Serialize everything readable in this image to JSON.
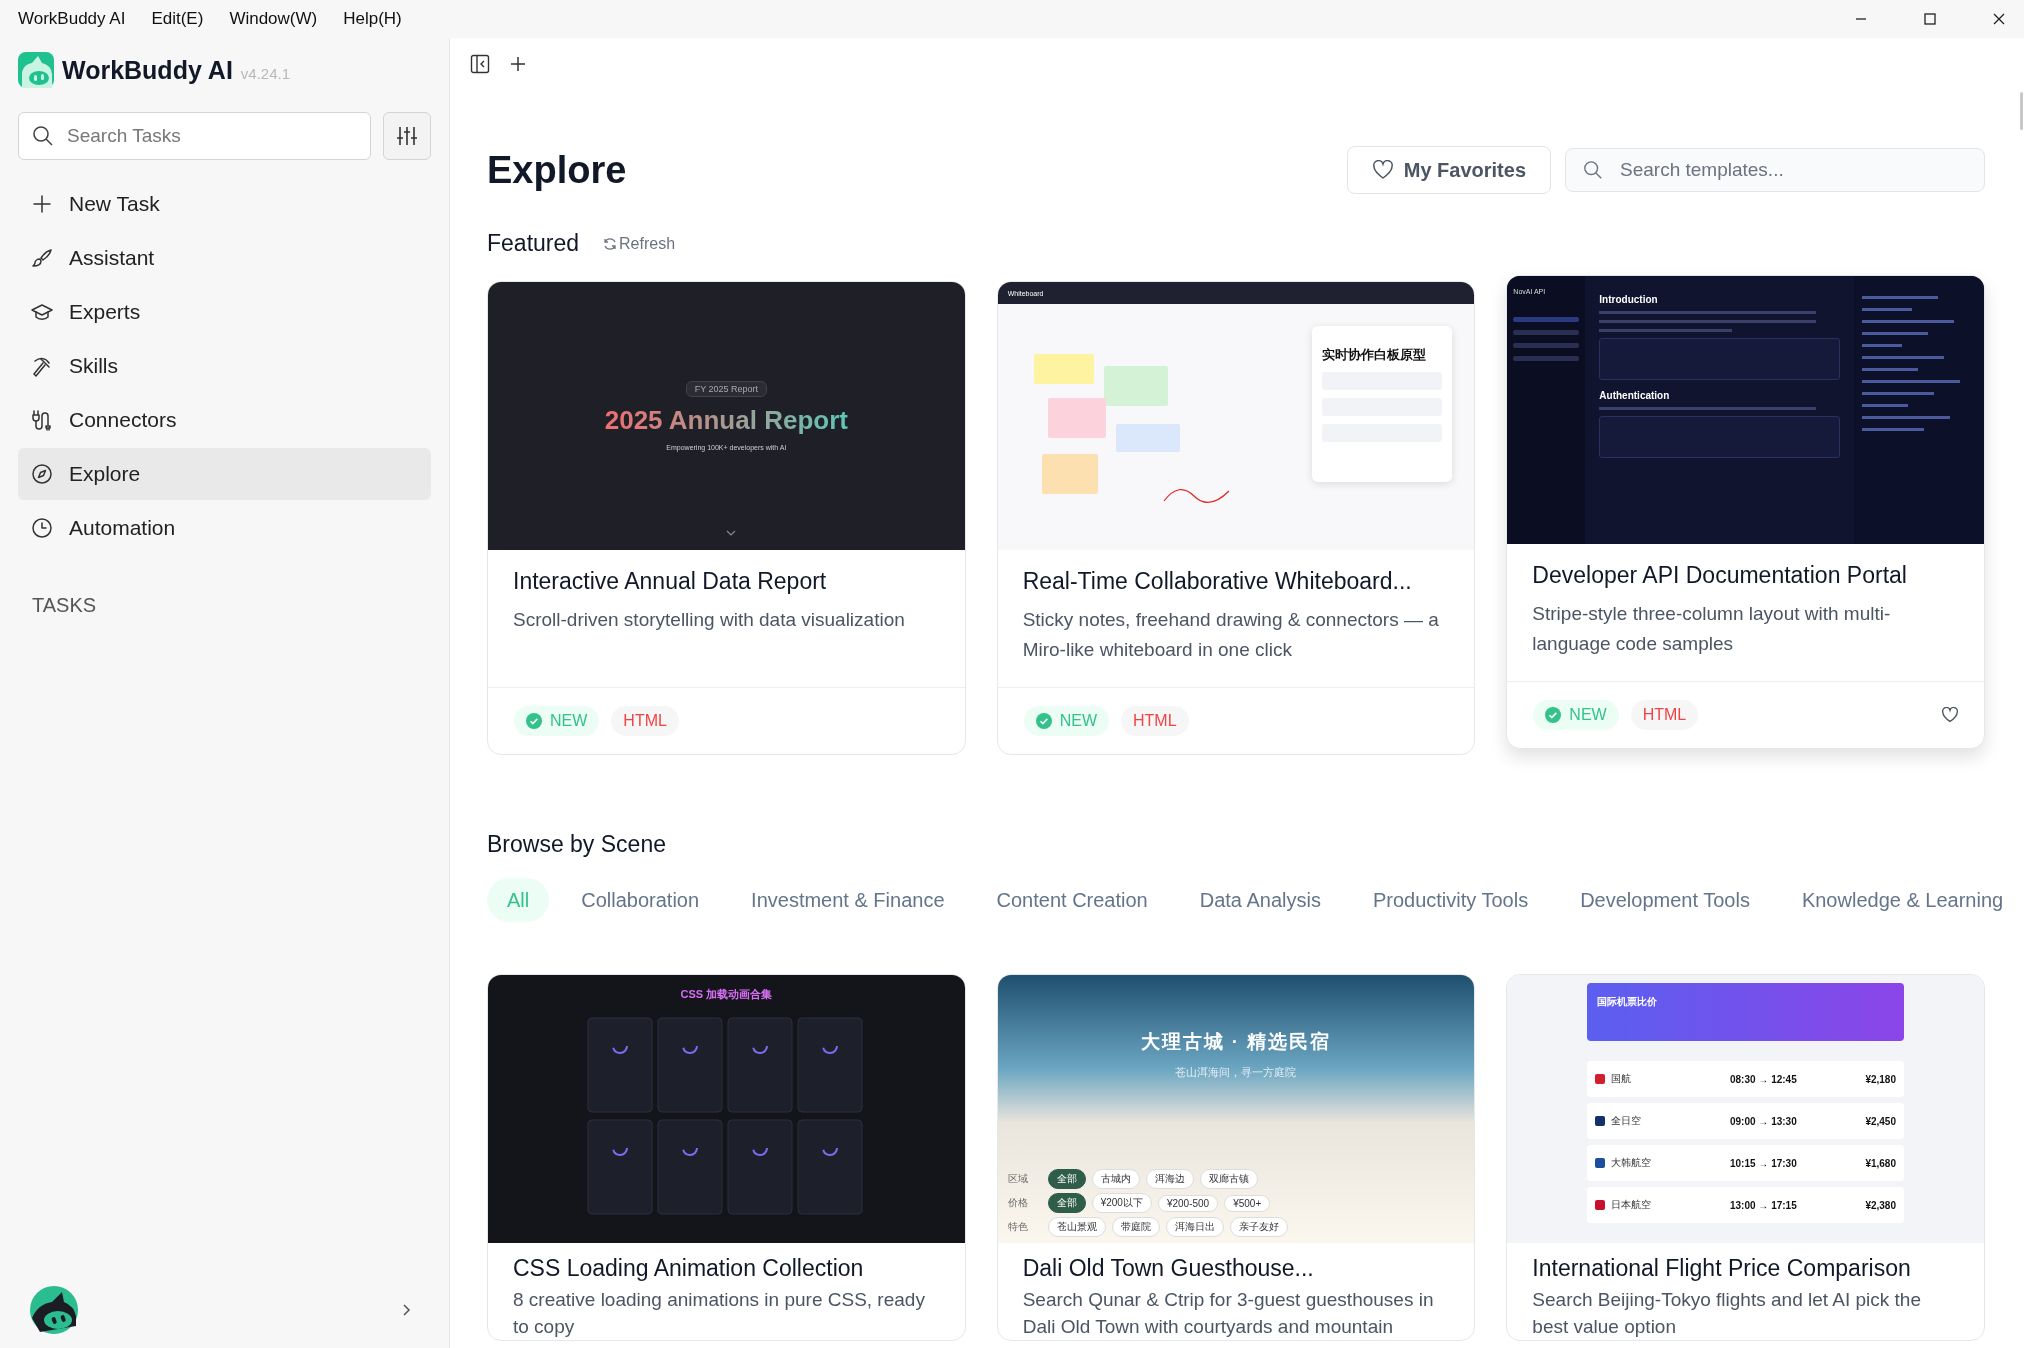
{
  "menu_bar": [
    "WorkBuddy AI",
    "Edit(E)",
    "Window(W)",
    "Help(H)"
  ],
  "app": {
    "name": "WorkBuddy AI",
    "version": "v4.24.1"
  },
  "sidebar": {
    "search": {
      "placeholder": "Search Tasks"
    },
    "items": [
      {
        "label": "New Task",
        "selected": false
      },
      {
        "label": "Assistant",
        "selected": false
      },
      {
        "label": "Experts",
        "selected": false
      },
      {
        "label": "Skills",
        "selected": false
      },
      {
        "label": "Connectors",
        "selected": false
      },
      {
        "label": "Explore",
        "selected": true
      },
      {
        "label": "Automation",
        "selected": false
      }
    ],
    "section": "TASKS"
  },
  "explore": {
    "title": "Explore",
    "favorites": "My Favorites",
    "search": {
      "placeholder": "Search templates..."
    }
  },
  "featured": {
    "title": "Featured",
    "refresh": "Refresh",
    "cards": [
      {
        "title": "Interactive Annual Data Report",
        "description": "Scroll-driven storytelling with data visualization",
        "hovered": false,
        "badges": [
          {
            "label": "NEW",
            "kind": "new"
          },
          {
            "label": "HTML",
            "kind": "format"
          }
        ],
        "preview": {
          "kind": "report",
          "tag": "FY 2025 Report",
          "headline": "2025 Annual Report",
          "subline": "Empowering 100K+ developers with AI"
        }
      },
      {
        "title": "Real-Time Collaborative Whiteboard...",
        "description": "Sticky notes, freehand drawing & connectors — a Miro-like whiteboard in one click",
        "hovered": false,
        "badges": [
          {
            "label": "NEW",
            "kind": "new"
          },
          {
            "label": "HTML",
            "kind": "format"
          }
        ],
        "preview": {
          "kind": "whiteboard",
          "app": "Whiteboard",
          "headline": "实时协作白板原型"
        }
      },
      {
        "title": "Developer API Documentation Portal",
        "description": "Stripe-style three-column layout with multi-language code samples",
        "hovered": true,
        "badges": [
          {
            "label": "NEW",
            "kind": "new"
          },
          {
            "label": "HTML",
            "kind": "format"
          }
        ],
        "preview": {
          "kind": "api_docs",
          "brand": "NovAI API",
          "headline": "Introduction",
          "section": "Authentication"
        }
      }
    ]
  },
  "browse": {
    "title": "Browse by Scene",
    "filters": [
      {
        "label": "All",
        "selected": true
      },
      {
        "label": "Collaboration",
        "selected": false
      },
      {
        "label": "Investment & Finance",
        "selected": false
      },
      {
        "label": "Content Creation",
        "selected": false
      },
      {
        "label": "Data Analysis",
        "selected": false
      },
      {
        "label": "Productivity Tools",
        "selected": false
      },
      {
        "label": "Development Tools",
        "selected": false
      },
      {
        "label": "Knowledge & Learning",
        "selected": false
      }
    ],
    "cards": [
      {
        "title": "CSS Loading Animation Collection",
        "description": "8 creative loading animations in pure CSS, ready to copy",
        "hovered": false,
        "preview": {
          "kind": "css_grid",
          "headline": "CSS 加载动画合集"
        }
      },
      {
        "title": "Dali Old Town Guesthouse...",
        "description": "Search Qunar & Ctrip for 3-guest guesthouses in Dali Old Town with courtyards and mountain",
        "hovered": false,
        "preview": {
          "kind": "dali",
          "headline": "大理古城 · 精选民宿",
          "subline": "苍山洱海间，寻一方庭院",
          "filters": [
            {
              "label": "区域",
              "options": [
                {
                  "label": "全部",
                  "selected": true
                },
                {
                  "label": "古城内",
                  "selected": false
                },
                {
                  "label": "洱海边",
                  "selected": false
                },
                {
                  "label": "双廊古镇",
                  "selected": false
                }
              ]
            },
            {
              "label": "价格",
              "options": [
                {
                  "label": "全部",
                  "selected": true
                },
                {
                  "label": "¥200以下",
                  "selected": false
                },
                {
                  "label": "¥200-500",
                  "selected": false
                },
                {
                  "label": "¥500+",
                  "selected": false
                }
              ]
            },
            {
              "label": "特色",
              "options": [
                {
                  "label": "苍山景观",
                  "selected": false
                },
                {
                  "label": "带庭院",
                  "selected": false
                },
                {
                  "label": "洱海日出",
                  "selected": false
                },
                {
                  "label": "亲子友好",
                  "selected": false
                }
              ]
            }
          ]
        }
      },
      {
        "title": "International Flight Price Comparison",
        "description": "Search Beijing-Tokyo flights and let AI pick the best value option",
        "hovered": false,
        "preview": {
          "kind": "flights",
          "headline": "国际机票比价",
          "rows": [
            {
              "airline": "国航",
              "times": "08:30 → 12:45",
              "price": "¥2,180",
              "color": "#d0202e"
            },
            {
              "airline": "全日空",
              "times": "09:00 → 13:30",
              "price": "¥2,450",
              "color": "#12306b"
            },
            {
              "airline": "大韩航空",
              "times": "10:15 → 17:30",
              "price": "¥1,680",
              "color": "#1a4f9c"
            },
            {
              "airline": "日本航空",
              "times": "13:00 → 17:15",
              "price": "¥2,380",
              "color": "#c8102e"
            }
          ]
        }
      }
    ]
  }
}
